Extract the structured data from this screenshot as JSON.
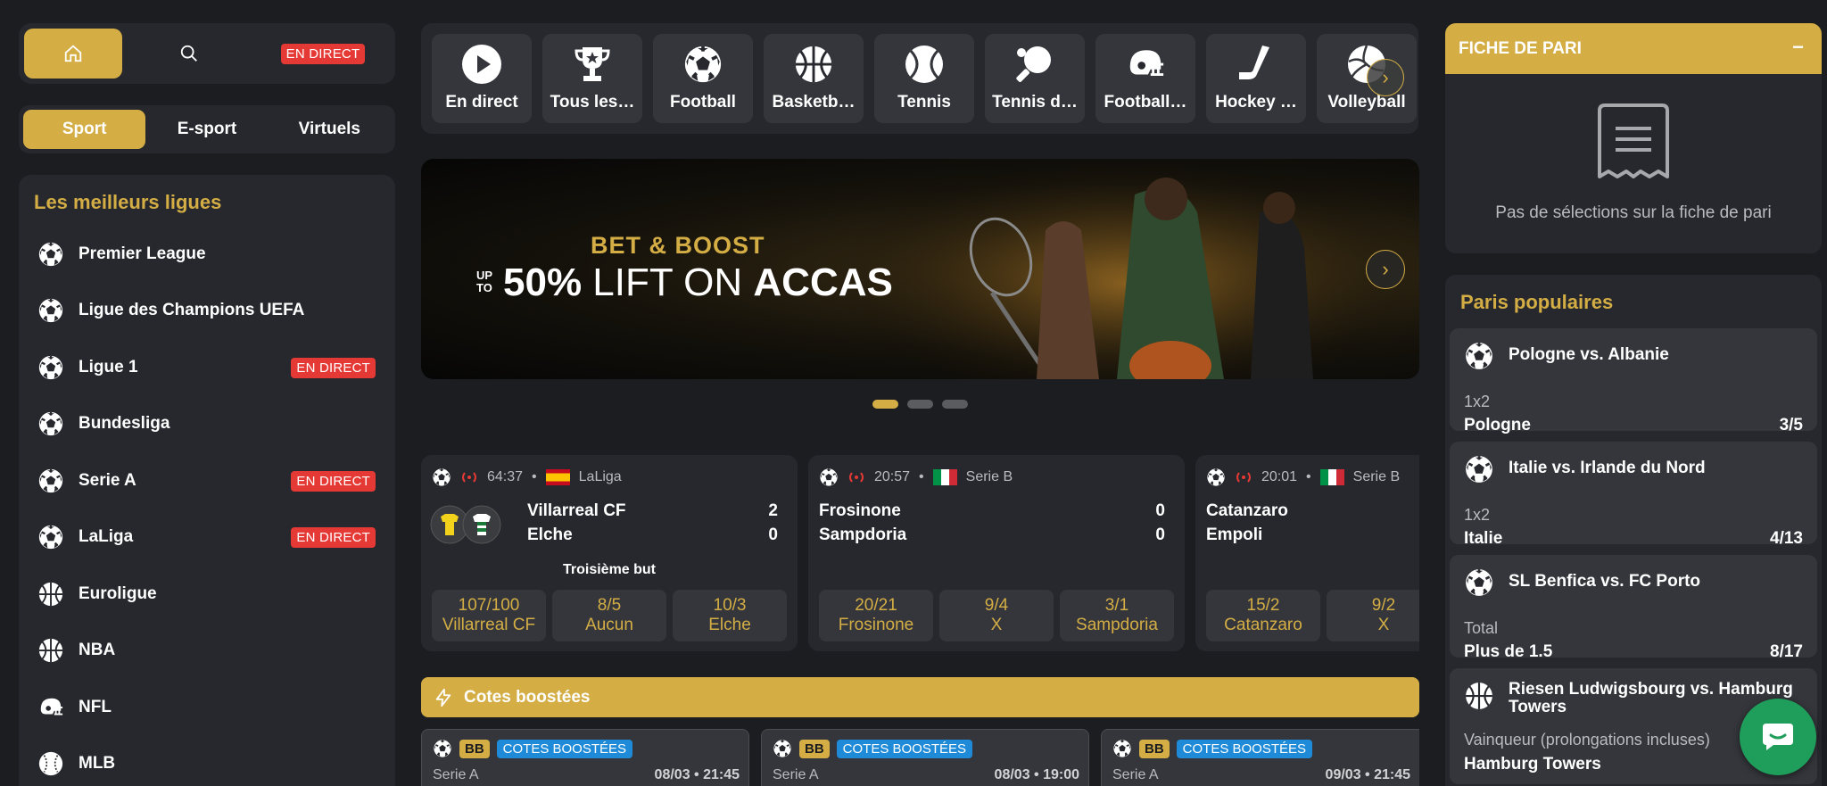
{
  "topnav": {
    "live_badge": "EN DIRECT"
  },
  "modes": [
    "Sport",
    "E-sport",
    "Virtuels"
  ],
  "leagues": {
    "title": "Les meilleurs ligues",
    "items": [
      {
        "label": "Premier League",
        "icon": "soccer-ball-icon",
        "live": ""
      },
      {
        "label": "Ligue des Champions UEFA",
        "icon": "soccer-ball-icon",
        "live": ""
      },
      {
        "label": "Ligue 1",
        "icon": "soccer-ball-icon",
        "live": "EN DIRECT"
      },
      {
        "label": "Bundesliga",
        "icon": "soccer-ball-icon",
        "live": ""
      },
      {
        "label": "Serie A",
        "icon": "soccer-ball-icon",
        "live": "EN DIRECT"
      },
      {
        "label": "LaLiga",
        "icon": "soccer-ball-icon",
        "live": "EN DIRECT"
      },
      {
        "label": "Euroligue",
        "icon": "basketball-icon",
        "live": ""
      },
      {
        "label": "NBA",
        "icon": "basketball-icon",
        "live": ""
      },
      {
        "label": "NFL",
        "icon": "football-helmet-icon",
        "live": ""
      },
      {
        "label": "MLB",
        "icon": "baseball-icon",
        "live": ""
      }
    ]
  },
  "sports": [
    {
      "label": "En direct",
      "icon": "play-icon"
    },
    {
      "label": "Tous les…",
      "icon": "trophy-icon"
    },
    {
      "label": "Football",
      "icon": "soccer-ball-icon"
    },
    {
      "label": "Basketb…",
      "icon": "basketball-icon"
    },
    {
      "label": "Tennis",
      "icon": "tennis-ball-icon"
    },
    {
      "label": "Tennis d…",
      "icon": "table-tennis-icon"
    },
    {
      "label": "Football…",
      "icon": "football-helmet-icon"
    },
    {
      "label": "Hockey …",
      "icon": "hockey-stick-icon"
    },
    {
      "label": "Volleyball",
      "icon": "volleyball-icon"
    }
  ],
  "banner": {
    "subtitle": "BET & BOOST",
    "upto_line1": "UP",
    "upto_line2": "TO",
    "percent": "50%",
    "middle": " LIFT ON ",
    "accas": "ACCAS"
  },
  "matches": [
    {
      "time": "64:37",
      "league": "LaLiga",
      "home": "Villarreal CF",
      "away": "Elche",
      "home_score": "2",
      "away_score": "0",
      "market": "Troisième but",
      "odds": [
        {
          "value": "107/100",
          "label": "Villarreal CF"
        },
        {
          "value": "8/5",
          "label": "Aucun"
        },
        {
          "value": "10/3",
          "label": "Elche"
        }
      ]
    },
    {
      "time": "20:57",
      "league": "Serie B",
      "home": "Frosinone",
      "away": "Sampdoria",
      "home_score": "0",
      "away_score": "0",
      "odds": [
        {
          "value": "20/21",
          "label": "Frosinone"
        },
        {
          "value": "9/4",
          "label": "X"
        },
        {
          "value": "3/1",
          "label": "Sampdoria"
        }
      ]
    },
    {
      "time": "20:01",
      "league": "Serie B",
      "home": "Catanzaro",
      "away": "Empoli",
      "odds": [
        {
          "value": "15/2",
          "label": "Catanzaro"
        },
        {
          "value": "9/2",
          "label": "X"
        }
      ]
    }
  ],
  "boosted": {
    "title": "Cotes boostées",
    "bb": "BB",
    "tag": "COTES BOOSTÉES",
    "cards": [
      {
        "league": "Serie A",
        "date": "08/03 • 21:45"
      },
      {
        "league": "Serie A",
        "date": "08/03 • 19:00"
      },
      {
        "league": "Serie A",
        "date": "09/03 • 21:45"
      }
    ]
  },
  "betslip": {
    "title": "FICHE DE PARI",
    "minimize": "−",
    "empty": "Pas de sélections sur la fiche de pari"
  },
  "popular": {
    "title": "Paris populaires",
    "items": [
      {
        "match": "Pologne vs. Albanie",
        "market": "1x2",
        "selection": "Pologne",
        "odd": "3/5",
        "icon": "soccer-ball-icon"
      },
      {
        "match": "Italie vs. Irlande du Nord",
        "market": "1x2",
        "selection": "Italie",
        "odd": "4/13",
        "icon": "soccer-ball-icon"
      },
      {
        "match": "SL Benfica vs. FC Porto",
        "market": "Total",
        "selection": "Plus de 1.5",
        "odd": "8/17",
        "icon": "soccer-ball-icon"
      },
      {
        "match": "Riesen Ludwigsbourg vs. Hamburg Towers",
        "market": "Vainqueur (prolongations incluses)",
        "selection": "Hamburg Towers",
        "odd": "",
        "icon": "basketball-icon"
      }
    ]
  },
  "colors": {
    "accent": "#d4ae45",
    "background": "#1b1d21",
    "panel": "#26282d",
    "live": "#e53935",
    "boost_tag": "#1f8bd8",
    "chat": "#1f9d5a"
  }
}
